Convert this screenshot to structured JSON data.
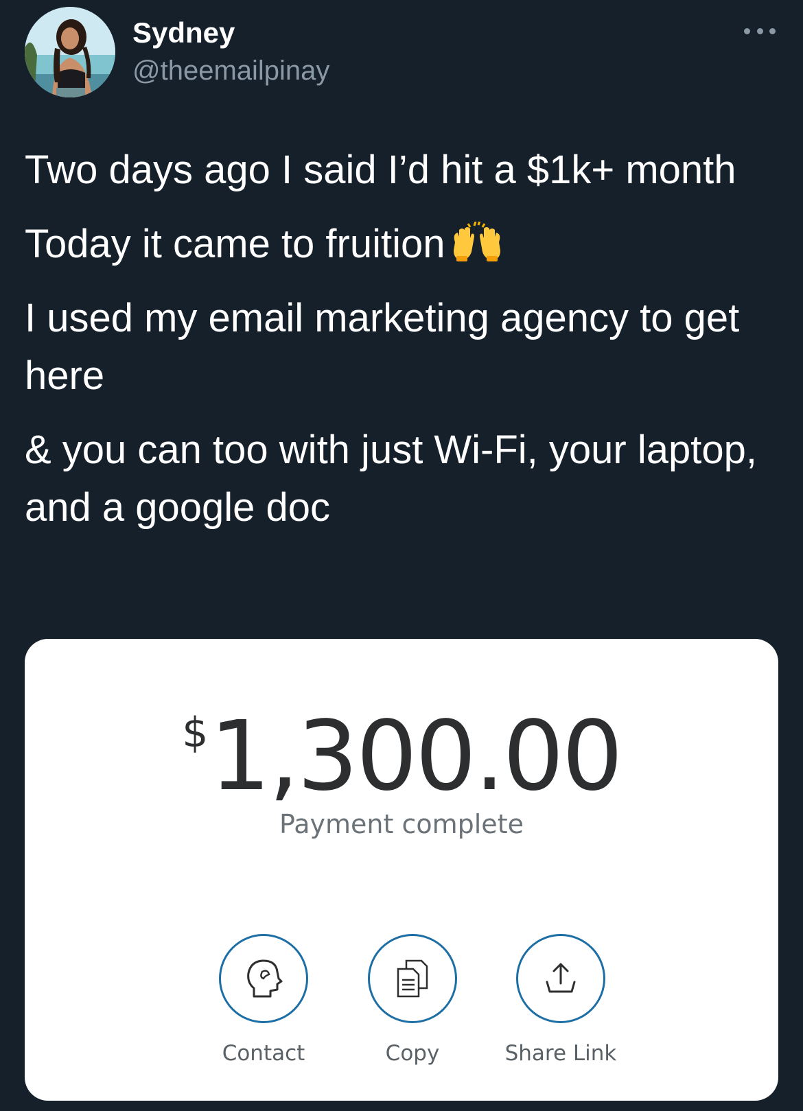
{
  "header": {
    "display_name": "Sydney",
    "handle": "@theemailpinay"
  },
  "tweet": {
    "paragraphs": [
      "Two days ago I said I’d hit a $1k+ month",
      "Today it came to fruition",
      "I used my email marketing agency to get here",
      "& you can too with just Wi-Fi, your laptop, and a google doc"
    ],
    "emoji": "raising-hands-emoji"
  },
  "payment_card": {
    "currency_symbol": "$",
    "amount": "1,300.00",
    "status": "Payment complete",
    "actions": [
      {
        "label": "Contact",
        "icon": "contact-head-icon"
      },
      {
        "label": "Copy",
        "icon": "copy-document-icon"
      },
      {
        "label": "Share Link",
        "icon": "share-upload-icon"
      }
    ]
  },
  "colors": {
    "background": "#15202b",
    "secondary_text": "#8b98a5",
    "card_background": "#ffffff",
    "action_accent": "#1c6ea4"
  }
}
